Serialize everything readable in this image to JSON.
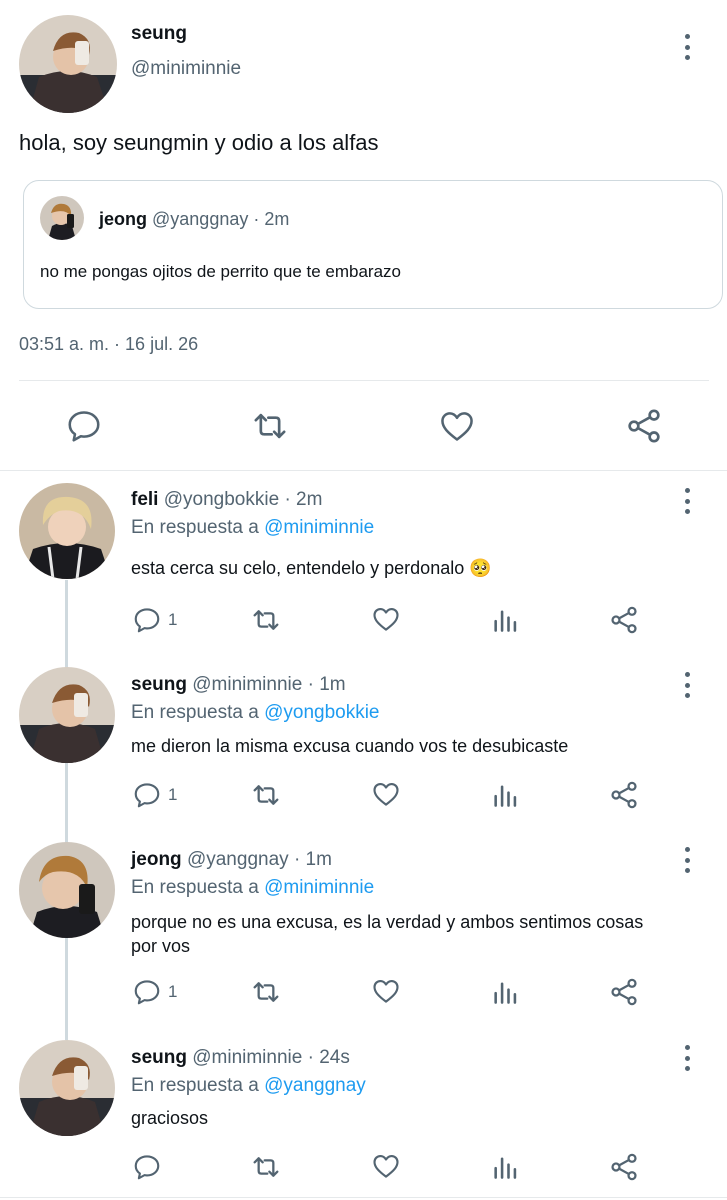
{
  "main_tweet": {
    "name": "seung",
    "handle": "@miniminnie",
    "text": "hola, soy seungmin y odio a los alfas",
    "quote": {
      "name": "jeong",
      "handle": "@yanggnay",
      "time": "· 2m",
      "text": "no me pongas ojitos de perrito que te embarazo"
    },
    "timestamp": "03:51 a. m. · 16 jul. 26"
  },
  "reply_prefix": "En respuesta a",
  "replies": [
    {
      "name": "feli",
      "handle": "@yongbokkie",
      "time": "· 2m",
      "reply_to": "@miniminnie",
      "text": "esta cerca su celo, entendelo y perdonalo 🥺",
      "reply_count": "1"
    },
    {
      "name": "seung",
      "handle": "@miniminnie",
      "time": "· 1m",
      "reply_to": "@yongbokkie",
      "text": "me dieron la misma excusa cuando vos te desubicaste",
      "reply_count": "1"
    },
    {
      "name": "jeong",
      "handle": "@yanggnay",
      "time": "· 1m",
      "reply_to": "@miniminnie",
      "text": "porque no es una excusa, es la verdad y ambos sentimos cosas por vos",
      "reply_count": "1"
    },
    {
      "name": "seung",
      "handle": "@miniminnie",
      "time": "· 24s",
      "reply_to": "@yanggnay",
      "text": "graciosos",
      "reply_count": ""
    }
  ],
  "icons": [
    "more-vertical-icon",
    "reply-icon",
    "retweet-icon",
    "like-icon",
    "analytics-icon",
    "share-icon"
  ],
  "colors": {
    "text": "#0f1419",
    "muted": "#536471",
    "link": "#1d9bf0",
    "divider": "#e6e9eb"
  }
}
